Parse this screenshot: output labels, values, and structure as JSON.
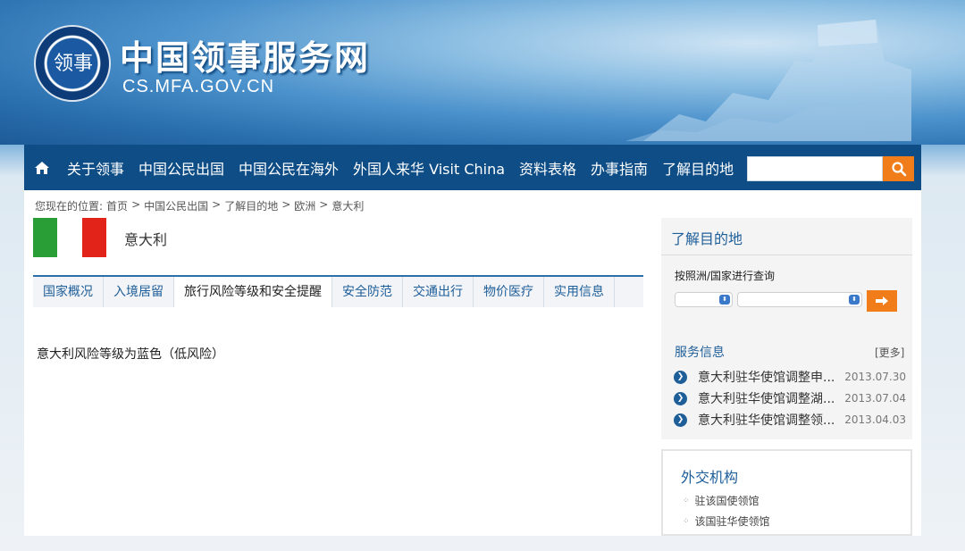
{
  "site": {
    "title": "中国领事服务网",
    "domain": "CS.MFA.GOV.CN"
  },
  "nav": {
    "home_icon": "home-icon",
    "items": [
      "关于领事",
      "中国公民出国",
      "中国公民在海外",
      "外国人来华 Visit China",
      "资料表格",
      "办事指南",
      "了解目的地"
    ],
    "search_placeholder": "",
    "search_icon": "search-icon"
  },
  "breadcrumb": {
    "prefix": "您现在的位置:",
    "path": [
      "首页",
      "中国公民出国",
      "了解目的地",
      "欧洲",
      "意大利"
    ],
    "separator": ">"
  },
  "country": {
    "name": "意大利",
    "flag_colors": [
      "#299e36",
      "#ffffff",
      "#e2231a"
    ]
  },
  "tabs": [
    "国家概况",
    "入境居留",
    "旅行风险等级和安全提醒",
    "安全防范",
    "交通出行",
    "物价医疗",
    "实用信息"
  ],
  "active_tab": "旅行风险等级和安全提醒",
  "content": {
    "risk_text": "意大利风险等级为蓝色（低风险）"
  },
  "sidebar": {
    "title": "了解目的地",
    "query_label": "按照洲/国家进行查询",
    "service_title": "服务信息",
    "more_label": "[更多]",
    "news": [
      {
        "title": "意大利驻华使馆调整申...",
        "date": "2013.07.30"
      },
      {
        "title": "意大利驻华使馆调整湖...",
        "date": "2013.07.04"
      },
      {
        "title": "意大利驻华使馆调整领...",
        "date": "2013.04.03"
      }
    ]
  },
  "diplomatic": {
    "title": "外交机构",
    "links": [
      "驻该国使领馆",
      "该国驻华使领馆"
    ]
  },
  "colors": {
    "nav_bg": "#0e4d86",
    "accent": "#f07d1a",
    "link": "#1e5e99"
  }
}
